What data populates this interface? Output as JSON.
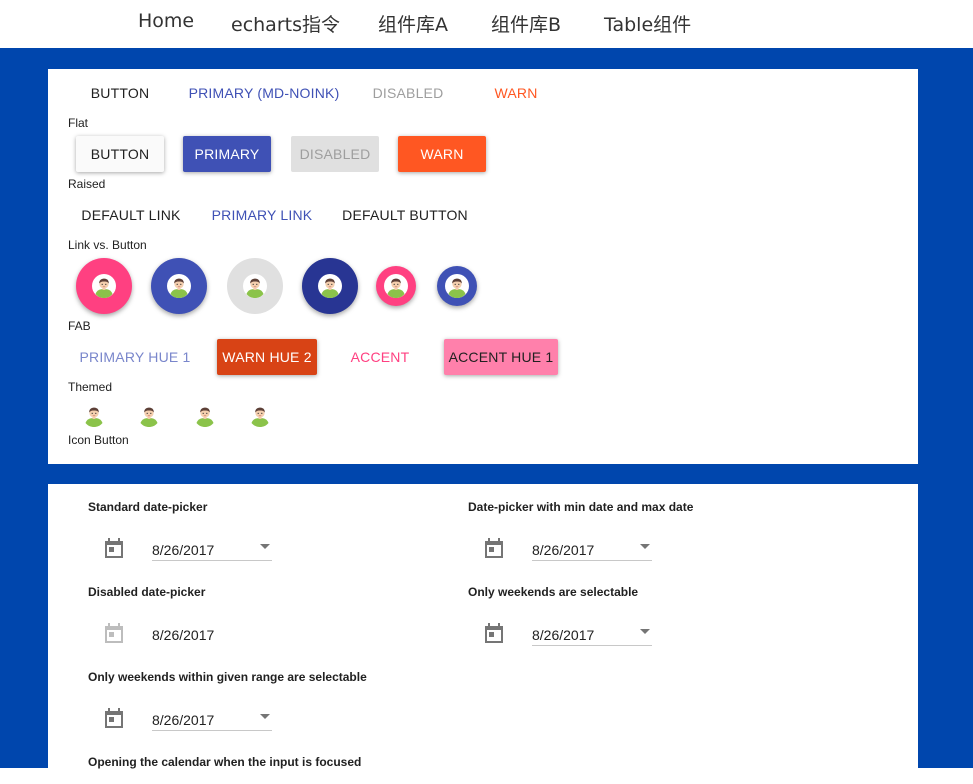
{
  "nav": {
    "items": [
      "Home",
      "echarts指令",
      "组件库A",
      "组件库B",
      "Table组件"
    ]
  },
  "colors": {
    "primary": "#3f51b5",
    "warn": "#ff5722",
    "accent": "#ff4081",
    "background": "#0046ad"
  },
  "buttons": {
    "flat": {
      "button": "Button",
      "primary": "Primary (md-noink)",
      "disabled": "Disabled",
      "warn": "Warn",
      "caption": "Flat"
    },
    "raised": {
      "button": "Button",
      "primary": "Primary",
      "disabled": "Disabled",
      "warn": "Warn",
      "caption": "Raised"
    },
    "link": {
      "default_link": "Default Link",
      "primary_link": "Primary Link",
      "default_button": "Default Button",
      "caption": "Link vs. Button"
    },
    "fab": {
      "caption": "FAB",
      "icon": "avatar-icon"
    },
    "themed": {
      "primary_hue1": "Primary Hue 1",
      "warn_hue2": "Warn Hue 2",
      "accent": "Accent",
      "accent_hue1": "Accent Hue 1",
      "caption": "Themed"
    },
    "icon_button": {
      "caption": "Icon Button"
    }
  },
  "datepickers": [
    {
      "label": "Standard date-picker",
      "value": "8/26/2017",
      "disabled": false
    },
    {
      "label": "Date-picker with min date and max date",
      "value": "8/26/2017",
      "disabled": false
    },
    {
      "label": "Disabled date-picker",
      "value": "8/26/2017",
      "disabled": true
    },
    {
      "label": "Only weekends are selectable",
      "value": "8/26/2017",
      "disabled": false
    },
    {
      "label": "Only weekends within given range are selectable",
      "value": "8/26/2017",
      "disabled": false
    },
    {
      "label": "Opening the calendar when the input is focused",
      "value": "",
      "disabled": false
    }
  ]
}
